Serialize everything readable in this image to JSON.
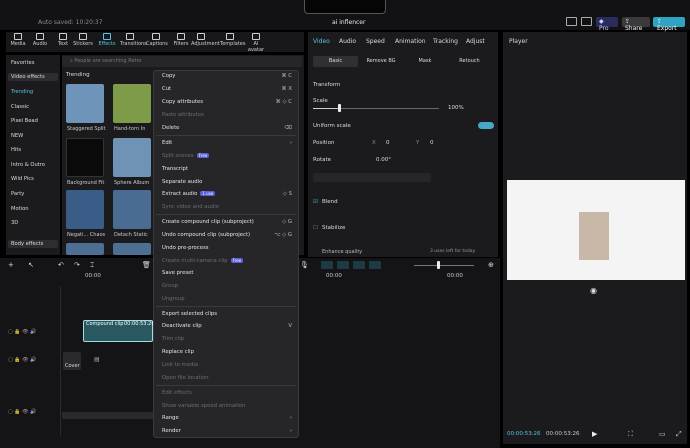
{
  "window": {
    "autosave": "Auto saved: 10:20:37",
    "project_name": "ai inflencer"
  },
  "header_buttons": {
    "pro": "Pro",
    "share": "Share",
    "export": "Export"
  },
  "media_tabs": [
    {
      "label": "Media",
      "icon": "media-icon"
    },
    {
      "label": "Audio",
      "icon": "audio-icon"
    },
    {
      "label": "Text",
      "icon": "text-icon"
    },
    {
      "label": "Stickers",
      "icon": "stickers-icon"
    },
    {
      "label": "Effects",
      "icon": "effects-icon"
    },
    {
      "label": "Transitions",
      "icon": "transitions-icon"
    },
    {
      "label": "Captions",
      "icon": "captions-icon"
    },
    {
      "label": "Filters",
      "icon": "filters-icon"
    },
    {
      "label": "Adjustment",
      "icon": "adjustment-icon"
    },
    {
      "label": "Templates",
      "icon": "templates-icon"
    },
    {
      "label": "AI avatar",
      "icon": "ai-avatar-icon"
    }
  ],
  "left_nav": [
    "Favorites",
    "Video effects",
    "Trending",
    "Classic",
    "Pixel Bead",
    "NEW",
    "Hits",
    "Intro & Outro",
    "Wild Pics",
    "Party",
    "Motion",
    "3D",
    "Body effects"
  ],
  "search": {
    "placeholder": "People are searching Retro"
  },
  "effects": {
    "section": "Trending",
    "items": [
      "Staggered Split",
      "Hand-torn In",
      "Background Fit",
      "Sphere Album",
      "Negati... Chaos",
      "Detach Static"
    ]
  },
  "context_menu": {
    "items": [
      {
        "label": "Copy",
        "shortcut": "⌘ C",
        "disabled": false
      },
      {
        "label": "Cut",
        "shortcut": "⌘ X",
        "disabled": false
      },
      {
        "label": "Copy attributes",
        "shortcut": "⌘ ◇ C",
        "disabled": false
      },
      {
        "label": "Paste attributes",
        "shortcut": "",
        "disabled": true
      },
      {
        "label": "Delete",
        "shortcut": "⌫",
        "disabled": false
      },
      {
        "label": "Edit",
        "shortcut": "›",
        "disabled": false
      },
      {
        "label": "Split scenes",
        "shortcut": "",
        "disabled": true,
        "tag": "Free"
      },
      {
        "label": "Transcript",
        "shortcut": "",
        "disabled": false
      },
      {
        "label": "Separate audio",
        "shortcut": "",
        "disabled": false
      },
      {
        "label": "Extract audio",
        "shortcut": "◇ S",
        "disabled": false,
        "tag": "1 use"
      },
      {
        "label": "Sync video and audio",
        "shortcut": "",
        "disabled": true
      },
      {
        "label": "Create compound clip (subproject)",
        "shortcut": "◇ G",
        "disabled": false
      },
      {
        "label": "Undo compound clip (subproject)",
        "shortcut": "⌥ ◇ G",
        "disabled": false
      },
      {
        "label": "Undo pre-process",
        "shortcut": "",
        "disabled": false
      },
      {
        "label": "Create multi-camera clip",
        "shortcut": "",
        "disabled": true,
        "tag": "Free"
      },
      {
        "label": "Save preset",
        "shortcut": "",
        "disabled": false
      },
      {
        "label": "Group",
        "shortcut": "",
        "disabled": true
      },
      {
        "label": "Ungroup",
        "shortcut": "",
        "disabled": true
      },
      {
        "label": "Export selected clips",
        "shortcut": "",
        "disabled": false
      },
      {
        "label": "Deactivate clip",
        "shortcut": "V",
        "disabled": false
      },
      {
        "label": "Trim clip",
        "shortcut": "",
        "disabled": true
      },
      {
        "label": "Replace clip",
        "shortcut": "",
        "disabled": false
      },
      {
        "label": "Link to media",
        "shortcut": "",
        "disabled": true
      },
      {
        "label": "Open file location",
        "shortcut": "",
        "disabled": true
      },
      {
        "label": "Edit effects",
        "shortcut": "",
        "disabled": true
      },
      {
        "label": "Show variable speed animation",
        "shortcut": "",
        "disabled": true
      },
      {
        "label": "Range",
        "shortcut": "›",
        "disabled": false
      },
      {
        "label": "Render",
        "shortcut": "›",
        "disabled": false
      }
    ]
  },
  "inspector": {
    "tabs": [
      "Video",
      "Audio",
      "Speed",
      "Animation",
      "Tracking",
      "Adjust"
    ],
    "subtabs": [
      "Basic",
      "Remove BG",
      "Mask",
      "Retouch"
    ],
    "transform": "Transform",
    "scale_label": "Scale",
    "scale_value": "100%",
    "scale_level": 0.2,
    "uniform_scale": "Uniform scale",
    "position_label": "Position",
    "position_x_label": "X",
    "position_x": "0",
    "position_y_label": "Y",
    "position_y": "0",
    "rotate_label": "Rotate",
    "rotate_value": "0.00°",
    "blend": "Blend",
    "stabilize": "Stabilize",
    "enhance": "Enhance quality",
    "uses_left": "3 uses left for today"
  },
  "player": {
    "title": "Player",
    "current_time": "00:00:53:26",
    "total_time": "00:00:53:26"
  },
  "timeline": {
    "ruler": [
      "00:00",
      "00:00",
      "00:00",
      "00:00"
    ],
    "clip_label": "Compound clip",
    "clip_time": "00:00:53:26",
    "cover_label": "Cover"
  }
}
